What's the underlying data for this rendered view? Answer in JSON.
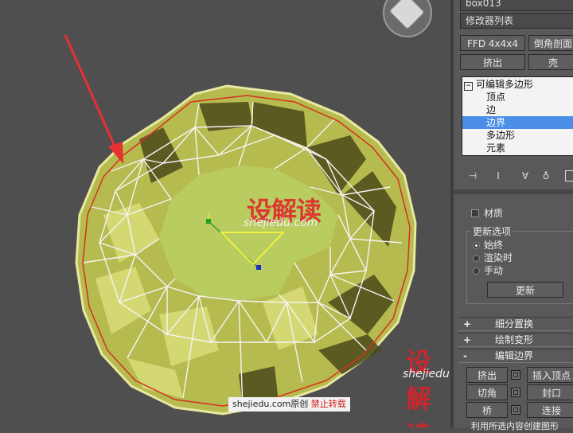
{
  "viewport": {
    "title": "perspective-viewport",
    "watermark_brand": "设解读",
    "watermark_url": "shejiedu.com",
    "credit": {
      "site": "shejiedu.com",
      "original": "原创",
      "notice": "禁止转载"
    }
  },
  "panel": {
    "object_name": "box013",
    "modifier_list": "修改器列表",
    "buttons_row1": [
      "FFD 4x4x4",
      "倒角剖面"
    ],
    "buttons_row2": [
      "挤出",
      "壳"
    ],
    "stack": {
      "root": "可编辑多边形",
      "items": [
        "顶点",
        "边",
        "边界",
        "多边形",
        "元素"
      ],
      "selected_index": 2
    },
    "material_label": "材质",
    "update_options": {
      "title": "更新选项",
      "options": [
        "始终",
        "渲染时",
        "手动"
      ],
      "selected_index": 0,
      "update_button": "更新"
    },
    "rollouts": [
      {
        "sign": "+",
        "label": "细分置换"
      },
      {
        "sign": "+",
        "label": "绘制变形"
      },
      {
        "sign": "-",
        "label": "编辑边界"
      }
    ],
    "edit_border_buttons": [
      {
        "left": "挤出",
        "right": "插入顶点"
      },
      {
        "left": "切角",
        "right": "封口"
      },
      {
        "left": "桥",
        "right": "连接"
      }
    ],
    "bottom_text": "利用所选内容创建图形"
  },
  "colors": {
    "background": "#4f4f4f",
    "mesh_fill": "#c3c85c",
    "wire": "#ffffff",
    "border_highlight": "#d63020",
    "arrow": "#e83030",
    "selection": "#4a8ee8",
    "watermark": "#e0202a"
  }
}
